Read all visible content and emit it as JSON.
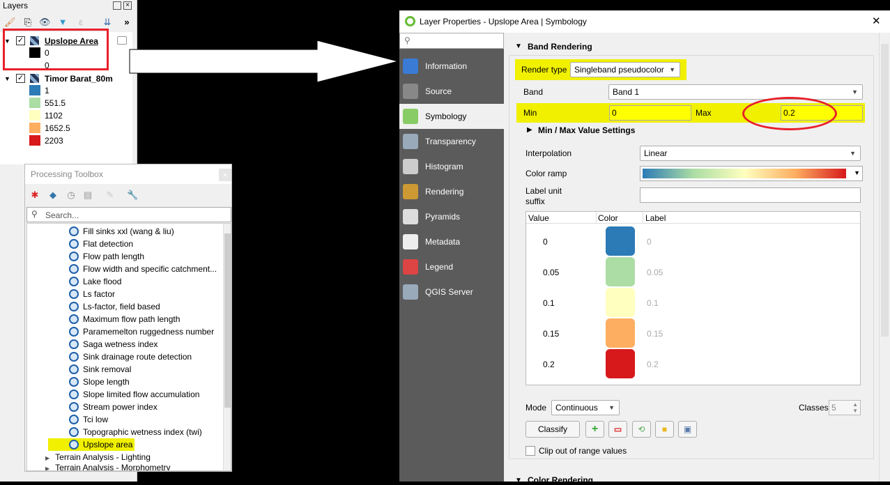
{
  "layers_panel": {
    "title": "Layers",
    "layers": [
      {
        "name": "Upslope Area",
        "legend": [
          {
            "value": "0",
            "color": "#000000"
          },
          {
            "value": "0",
            "color": null
          }
        ]
      },
      {
        "name": "Timor Barat_80m",
        "legend": [
          {
            "value": "1",
            "color": "#2c7bb6"
          },
          {
            "value": "551.5",
            "color": "#abdda4"
          },
          {
            "value": "1102",
            "color": "#ffffbf"
          },
          {
            "value": "1652.5",
            "color": "#fdae61"
          },
          {
            "value": "2203",
            "color": "#d7191c"
          }
        ]
      }
    ]
  },
  "toolbox": {
    "title": "Processing Toolbox",
    "search_placeholder": "Search...",
    "algorithms": [
      "Fill sinks xxl (wang & liu)",
      "Flat detection",
      "Flow path length",
      "Flow width and specific catchment...",
      "Lake flood",
      "Ls factor",
      "Ls-factor, field based",
      "Maximum flow path length",
      "Paramemelton ruggedness number",
      "Saga wetness index",
      "Sink drainage route detection",
      "Sink removal",
      "Slope length",
      "Slope limited flow accumulation",
      "Stream power index",
      "Tci low",
      "Topographic wetness index (twi)",
      "Upslope area"
    ],
    "highlighted": "Upslope area",
    "groups": [
      "Terrain Analysis - Lighting",
      "Terrain Analysis - Morphometry"
    ]
  },
  "dialog": {
    "title": "Layer Properties - Upslope Area | Symbology",
    "close": "✕",
    "sidebar": [
      {
        "label": "Information",
        "icon": "info-icon",
        "color": "#3a7bd5"
      },
      {
        "label": "Source",
        "icon": "source-icon",
        "color": "#888"
      },
      {
        "label": "Symbology",
        "icon": "symbology-icon",
        "color": "#8c6"
      },
      {
        "label": "Transparency",
        "icon": "transparency-icon",
        "color": "#9ab"
      },
      {
        "label": "Histogram",
        "icon": "histogram-icon",
        "color": "#ccc"
      },
      {
        "label": "Rendering",
        "icon": "rendering-icon",
        "color": "#c93"
      },
      {
        "label": "Pyramids",
        "icon": "pyramids-icon",
        "color": "#ddd"
      },
      {
        "label": "Metadata",
        "icon": "metadata-icon",
        "color": "#eee"
      },
      {
        "label": "Legend",
        "icon": "legend-icon",
        "color": "#d44"
      },
      {
        "label": "QGIS Server",
        "icon": "server-icon",
        "color": "#9ab"
      }
    ],
    "selected": "Symbology",
    "band_rendering": {
      "header": "Band Rendering",
      "render_type_label": "Render type",
      "render_type": "Singleband pseudocolor",
      "band_label": "Band",
      "band": "Band 1",
      "min_label": "Min",
      "min": "0",
      "max_label": "Max",
      "max": "0.2",
      "minmax_settings": "Min / Max Value Settings",
      "interpolation_label": "Interpolation",
      "interpolation": "Linear",
      "color_ramp_label": "Color ramp",
      "label_unit_label": "Label unit suffix",
      "label_unit": "",
      "table_headers": [
        "Value",
        "Color",
        "Label"
      ],
      "classes_table": [
        {
          "value": "0",
          "color": "#2c7bb6",
          "label": "0"
        },
        {
          "value": "0.05",
          "color": "#abdda4",
          "label": "0.05"
        },
        {
          "value": "0.1",
          "color": "#ffffbf",
          "label": "0.1"
        },
        {
          "value": "0.15",
          "color": "#fdae61",
          "label": "0.15"
        },
        {
          "value": "0.2",
          "color": "#d7191c",
          "label": "0.2"
        }
      ],
      "mode_label": "Mode",
      "mode": "Continuous",
      "classes_label": "Classes",
      "classes": "5",
      "classify": "Classify",
      "clip_label": "Clip out of range values",
      "clip_checked": false
    },
    "color_rendering": "Color Rendering"
  },
  "colors": {
    "highlight": "#f0f000",
    "annotation_red": "#e8202a"
  }
}
